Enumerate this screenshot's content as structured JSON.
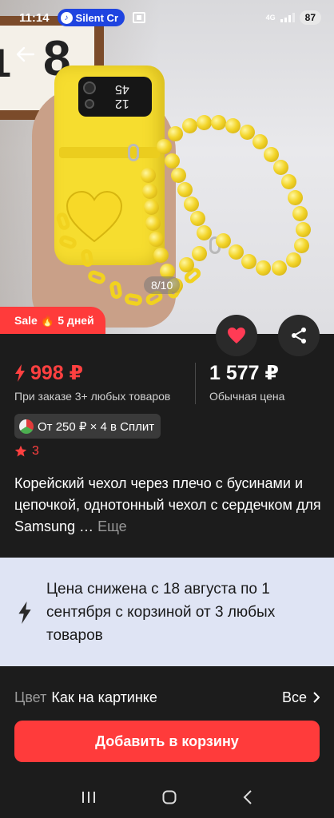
{
  "status_bar": {
    "time": "11:14",
    "pill_label": "Silent Cr",
    "network": "4G",
    "battery": "87"
  },
  "gallery": {
    "counter": "8/10"
  },
  "sale_badge": {
    "label": "Sale",
    "emoji": "🔥",
    "days": "5 дней"
  },
  "price": {
    "discount_price": "998 ₽",
    "discount_note": "При заказе 3+ любых товаров",
    "regular_price": "1 577 ₽",
    "regular_note": "Обычная цена"
  },
  "split": {
    "label": "От 250 ₽ × 4 в Сплит"
  },
  "rating": {
    "value": "3"
  },
  "product": {
    "title": "Корейский чехол через плечо с бусинами и цепочкой, однотонный чехол с сердечком для Samsung …",
    "more": "Еще"
  },
  "promo_banner": {
    "text": "Цена снижена с 18 августа по 1 сентября с корзиной от 3 любых товаров"
  },
  "variant": {
    "label": "Цвет",
    "value": "Как на картинке",
    "all": "Все"
  },
  "cart_button": {
    "label": "Добавить в корзину"
  },
  "colors": {
    "accent": "#ff3b3b",
    "background": "#1c1c1c",
    "banner": "#dfe4f4"
  }
}
